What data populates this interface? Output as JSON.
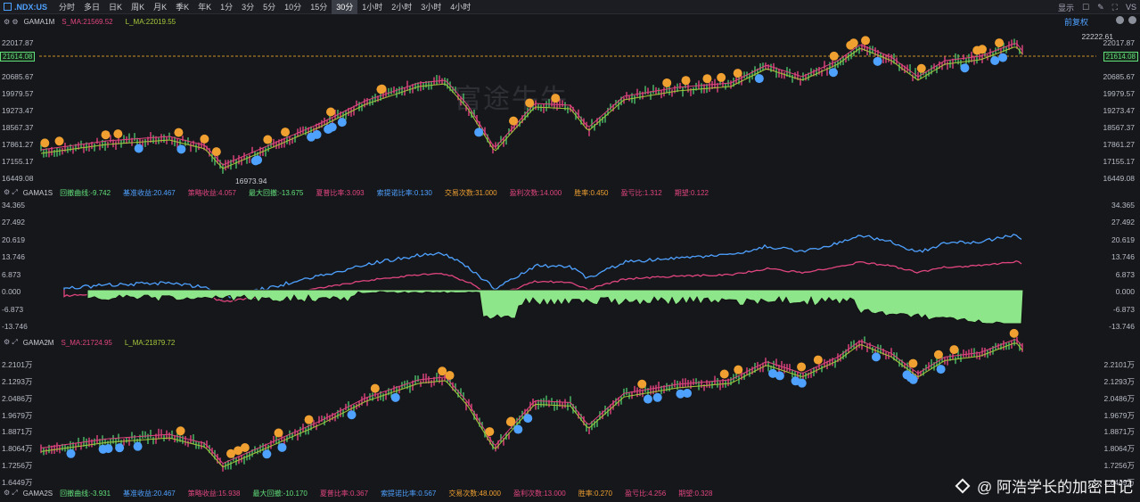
{
  "toolbar": {
    "symbol": ".NDX:US",
    "timeframes": [
      "分时",
      "多日",
      "日K",
      "周K",
      "月K",
      "季K",
      "年K",
      "1分",
      "3分",
      "5分",
      "10分",
      "15分",
      "30分",
      "1小时",
      "2小时",
      "3小时",
      "4小时"
    ],
    "active_timeframe": "30分",
    "display_label": "显示",
    "vs_label": "VS"
  },
  "panel1": {
    "name": "GAMA1M",
    "s_ma": "S_MA:21569.52",
    "l_ma": "L_MA:22019.55",
    "adjust_label": "前复权",
    "high_label": "22222.61",
    "low_label": "16973.94",
    "current_price": "21614.08",
    "axis_ticks": [
      "22017.87",
      "21614.08",
      "20685.67",
      "19979.57",
      "19273.47",
      "18567.37",
      "17861.27",
      "17155.17",
      "16449.08"
    ],
    "watermark": "富途牛牛"
  },
  "panel2": {
    "name": "GAMA1S",
    "stats": [
      {
        "label": "回撤曲线:-9.742",
        "color": "#62e07a"
      },
      {
        "label": "基准收益:20.467",
        "color": "#4ea1ff"
      },
      {
        "label": "策略收益:4.057",
        "color": "#e0457f"
      },
      {
        "label": "最大回撤:-13.675",
        "color": "#62e07a"
      },
      {
        "label": "夏普比率:3.093",
        "color": "#e0457f"
      },
      {
        "label": "索提诺比率:0.130",
        "color": "#4ea1ff"
      },
      {
        "label": "交易次数:31.000",
        "color": "#f0a030"
      },
      {
        "label": "盈利次数:14.000",
        "color": "#e0457f"
      },
      {
        "label": "胜率:0.450",
        "color": "#f0a030"
      },
      {
        "label": "盈亏比:1.312",
        "color": "#e0457f"
      },
      {
        "label": "期望:0.122",
        "color": "#e0457f"
      }
    ],
    "axis_ticks": [
      "34.365",
      "27.492",
      "20.619",
      "13.746",
      "6.873",
      "0.000",
      "-6.873",
      "-13.746"
    ]
  },
  "panel3": {
    "name": "GAMA2M",
    "s_ma": "S_MA:21724.95",
    "l_ma": "L_MA:21879.72",
    "axis_ticks": [
      "2.2101万",
      "2.1293万",
      "2.0486万",
      "1.9679万",
      "1.8871万",
      "1.8064万",
      "1.7256万",
      "1.6449万"
    ]
  },
  "panel4": {
    "name": "GAMA2S",
    "stats": [
      {
        "label": "回撤曲线:-3.931",
        "color": "#62e07a"
      },
      {
        "label": "基准收益:20.467",
        "color": "#4ea1ff"
      },
      {
        "label": "策略收益:15.938",
        "color": "#e0457f"
      },
      {
        "label": "最大回撤:-10.170",
        "color": "#62e07a"
      },
      {
        "label": "夏普比率:0.367",
        "color": "#e0457f"
      },
      {
        "label": "索提诺比率:0.567",
        "color": "#4ea1ff"
      },
      {
        "label": "交易次数:48.000",
        "color": "#f0a030"
      },
      {
        "label": "盈利次数:13.000",
        "color": "#e0457f"
      },
      {
        "label": "胜率:0.270",
        "color": "#f0a030"
      },
      {
        "label": "盈亏比:4.256",
        "color": "#e0457f"
      },
      {
        "label": "期望:0.328",
        "color": "#e0457f"
      }
    ]
  },
  "footer_watermark": "@ 阿浩学长的加密日记",
  "colors": {
    "blue": "#4ea1ff",
    "magenta": "#e0457f",
    "green": "#62e07a",
    "orange": "#f0a030",
    "olive": "#a6c83a"
  }
}
